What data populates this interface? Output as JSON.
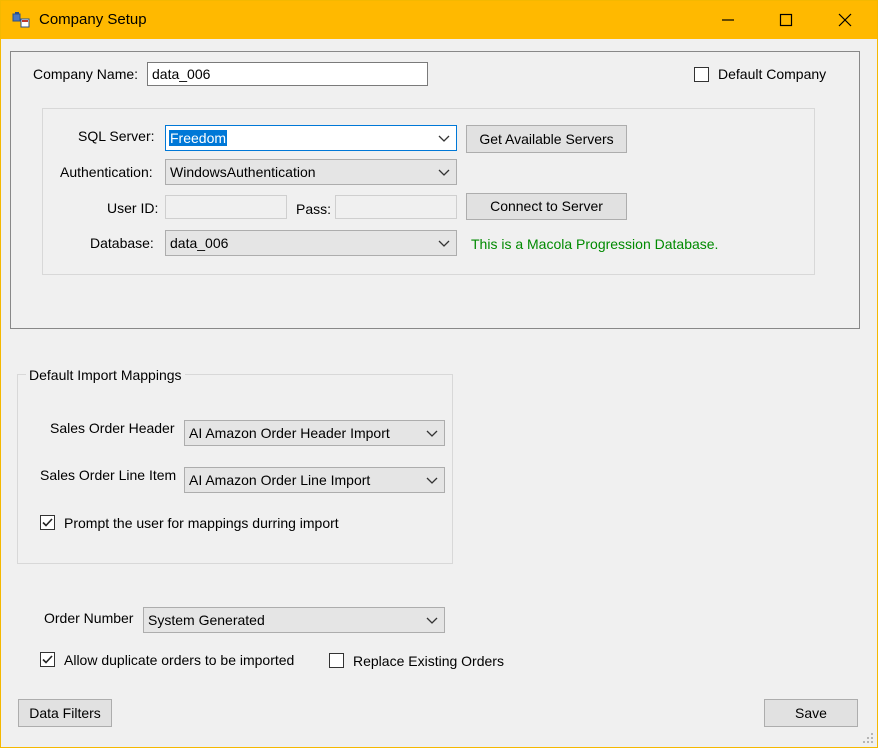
{
  "window": {
    "title": "Company Setup",
    "accent_color": "#ffb900",
    "icons": [
      "app-icon",
      "minimize-icon",
      "maximize-icon",
      "close-icon"
    ]
  },
  "company": {
    "name_label": "Company Name:",
    "name_value": "data_006",
    "default_company_label": "Default Company",
    "default_company_checked": false
  },
  "connection": {
    "sql_server_label": "SQL Server:",
    "sql_server_value": "Freedom",
    "get_servers_button": "Get Available Servers",
    "authentication_label": "Authentication:",
    "authentication_value": "WindowsAuthentication",
    "user_id_label": "User ID:",
    "user_id_value": "",
    "pass_label": "Pass:",
    "pass_value": "",
    "connect_button": "Connect to Server",
    "database_label": "Database:",
    "database_value": "data_006",
    "status_message": "This is a Macola Progression Database.",
    "status_color": "#008a00"
  },
  "import_mappings": {
    "group_title": "Default Import Mappings",
    "header_label": "Sales Order Header",
    "header_value": "AI Amazon Order Header Import",
    "line_label": "Sales Order Line Item",
    "line_value": "AI Amazon Order Line Import",
    "prompt_label": "Prompt the user for mappings durring import",
    "prompt_checked": true
  },
  "orders": {
    "order_number_label": "Order Number",
    "order_number_value": "System Generated",
    "allow_duplicates_label": "Allow duplicate orders to be imported",
    "allow_duplicates_checked": true,
    "replace_existing_label": "Replace Existing Orders",
    "replace_existing_checked": false
  },
  "footer": {
    "data_filters_button": "Data Filters",
    "save_button": "Save"
  }
}
